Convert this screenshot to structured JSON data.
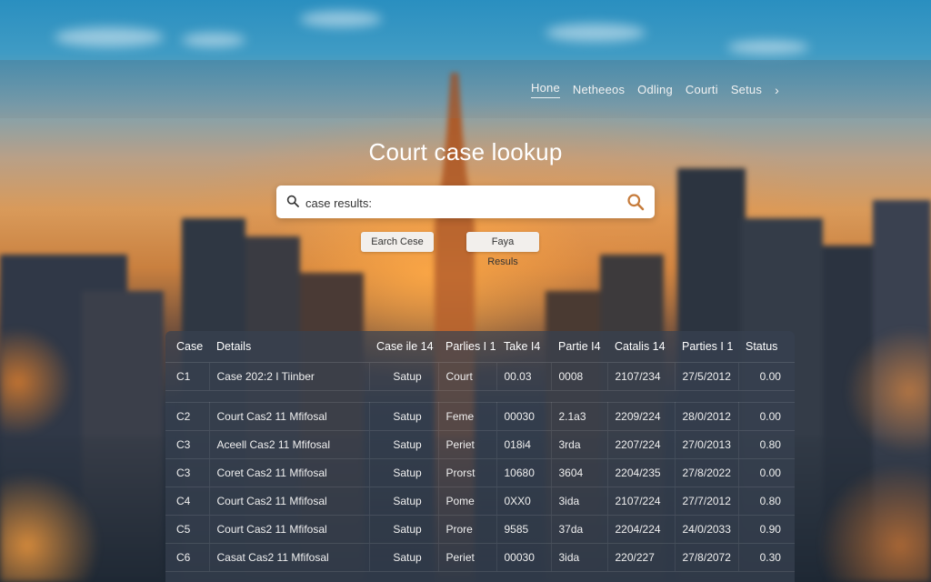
{
  "page": {
    "title": "Court case lookup"
  },
  "nav": {
    "items": [
      {
        "label": "Hone",
        "active": true
      },
      {
        "label": "Netheeos",
        "active": false
      },
      {
        "label": "Odling",
        "active": false
      },
      {
        "label": "Courti",
        "active": false
      },
      {
        "label": "Setus",
        "active": false
      }
    ],
    "more_icon": "chevron-right-icon"
  },
  "search": {
    "value": "",
    "placeholder": "case results:",
    "left_icon": "search-icon",
    "right_icon": "search-icon",
    "accent_color": "#c67c3c"
  },
  "buttons": {
    "search_label": "Earch Cese",
    "results_label": "Faya Resuls"
  },
  "table": {
    "columns": [
      "Case",
      "Details",
      "Case ile 14",
      "Parlies I 1",
      "Take I4",
      "Partie I4",
      "Catalis 14",
      "Parties I 1",
      "Status"
    ],
    "rows": [
      [
        "C1",
        "Case 202:2 I Tiinber",
        "Satup",
        "Court",
        "00.03",
        "0008",
        "2107/234",
        "27/5/2012",
        "0.00"
      ],
      [
        "C2",
        "Court Cas2 11 Mfifosal",
        "Satup",
        "Feme",
        "00030",
        "2.1a3",
        "2209/224",
        "28/0/2012",
        "0.00"
      ],
      [
        "C3",
        "Aceell Cas2 11 Mfifosal",
        "Satup",
        "Periet",
        "018i4",
        "3rda",
        "2207/224",
        "27/0/2013",
        "0.80"
      ],
      [
        "C3",
        "Coret Cas2 11 Mfifosal",
        "Satup",
        "Prorst",
        "10680",
        "3604",
        "2204/235",
        "27/8/2022",
        "0.00"
      ],
      [
        "C4",
        "Court Cas2 11 Mfifosal",
        "Satup",
        "Pome",
        "0XX0",
        "3ida",
        "2107/224",
        "27/7/2012",
        "0.80"
      ],
      [
        "C5",
        "Court Cas2 11 Mfifosal",
        "Satup",
        "Prore",
        "9585",
        "37da",
        "2204/224",
        "24/0/2033",
        "0.90"
      ],
      [
        "C6",
        "Casat Cas2 11 Mfifosal",
        "Satup",
        "Periet",
        "00030",
        "3ida",
        "220/227",
        "27/8/2072",
        "0.30"
      ]
    ]
  }
}
